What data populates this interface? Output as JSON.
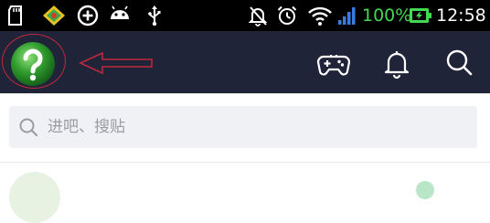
{
  "status_bar": {
    "battery_percent": "100%",
    "time": "12:58",
    "left_icons": [
      "sd-card-icon",
      "app-notification-icon",
      "add-circle-icon",
      "android-icon",
      "usb-icon"
    ],
    "right_icons": [
      "silent-icon",
      "alarm-icon",
      "wifi-icon",
      "signal-icon",
      "battery-charging-icon"
    ],
    "battery_text_color": "#43d854"
  },
  "header": {
    "background": "#1f2439",
    "help_icon_color": "#2e9b2c",
    "annotation_color": "#c0283a",
    "buttons": [
      "game-controller-icon",
      "notification-bell-icon",
      "search-icon"
    ]
  },
  "search": {
    "placeholder": "进吧、搜贴"
  }
}
